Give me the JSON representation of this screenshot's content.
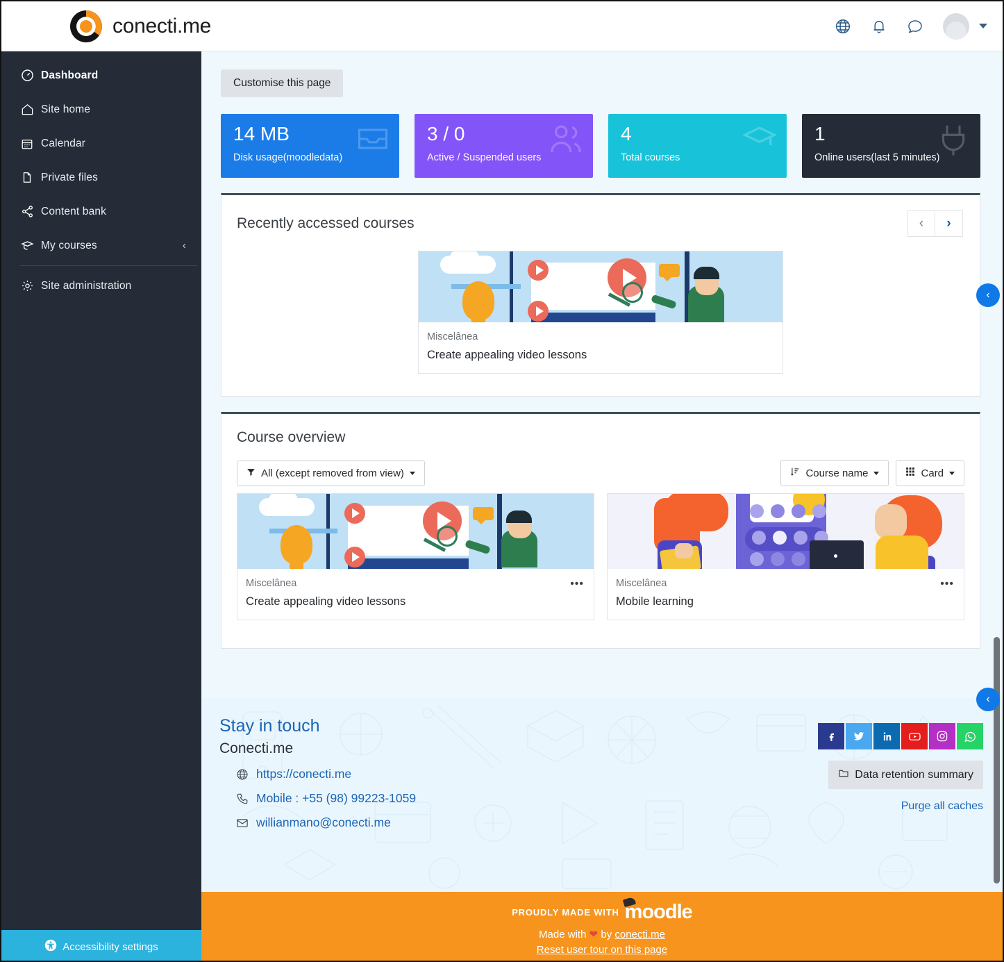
{
  "header": {
    "menu_toggle": "menu-toggle",
    "logo_text": "conecti.me",
    "icons": [
      "globe-icon",
      "bell-icon",
      "message-icon",
      "avatar",
      "chevron-down-icon"
    ]
  },
  "sidebar": {
    "items": [
      {
        "label": "Dashboard",
        "icon": "dashboard-icon",
        "active": true
      },
      {
        "label": "Site home",
        "icon": "home-icon",
        "active": false
      },
      {
        "label": "Calendar",
        "icon": "calendar-icon",
        "active": false
      },
      {
        "label": "Private files",
        "icon": "file-icon",
        "active": false
      },
      {
        "label": "Content bank",
        "icon": "share-icon",
        "active": false
      },
      {
        "label": "My courses",
        "icon": "graduation-cap-icon",
        "active": false,
        "chevron": "‹"
      },
      {
        "label": "Site administration",
        "icon": "gear-icon",
        "active": false
      }
    ],
    "accessibility_label": "Accessibility settings"
  },
  "main": {
    "customise_button": "Customise this page",
    "stats": [
      {
        "value": "14 MB",
        "label": "Disk usage(moodledata)",
        "color": "#1b7ce8",
        "icon": "inbox-icon"
      },
      {
        "value": "3 / 0",
        "label": "Active / Suspended users",
        "color": "#8354f7",
        "icon": "users-icon"
      },
      {
        "value": "4",
        "label": "Total courses",
        "color": "#18c3da",
        "icon": "graduation-cap-icon"
      },
      {
        "value": "1",
        "label": "Online users(last 5 minutes)",
        "color": "#252c38",
        "icon": "plug-icon"
      }
    ],
    "recently_accessed": {
      "title": "Recently accessed courses",
      "prev_label": "‹",
      "next_label": "›",
      "cards": [
        {
          "category": "Miscelânea",
          "name": "Create appealing video lessons",
          "illustration": "video-lessons"
        }
      ]
    },
    "course_overview": {
      "title": "Course overview",
      "filter_label": "All (except removed from view)",
      "sort_label": "Course name",
      "view_label": "Card",
      "cards": [
        {
          "category": "Miscelânea",
          "name": "Create appealing video lessons",
          "illustration": "video-lessons",
          "menu": "•••"
        },
        {
          "category": "Miscelânea",
          "name": "Mobile learning",
          "illustration": "mobile-learning",
          "menu": "•••"
        }
      ]
    }
  },
  "footer": {
    "stay_title": "Stay in touch",
    "brand": "Conecti.me",
    "contacts": [
      {
        "icon": "globe-icon",
        "text": "https://conecti.me"
      },
      {
        "icon": "phone-icon",
        "text": "Mobile : +55 (98) 99223-1059"
      },
      {
        "icon": "mail-icon",
        "text": "willianmano@conecti.me"
      }
    ],
    "socials": [
      {
        "name": "facebook-icon",
        "color": "#2a3b8f"
      },
      {
        "name": "twitter-icon",
        "color": "#4aa8f0"
      },
      {
        "name": "linkedin-icon",
        "color": "#0b6ab0"
      },
      {
        "name": "youtube-icon",
        "color": "#e41d1d"
      },
      {
        "name": "instagram-icon",
        "color": "#b42fc4"
      },
      {
        "name": "whatsapp-icon",
        "color": "#25d366"
      }
    ],
    "data_retention": "Data retention summary",
    "purge_caches": "Purge all caches"
  },
  "moodle_bar": {
    "proudly": "PROUDLY MADE WITH",
    "moodle": "moodle",
    "made_with_prefix": "Made with",
    "heart": "❤",
    "made_with_by": "by",
    "made_with_link": "conecti.me",
    "reset_tour": "Reset user tour on this page"
  },
  "drawers": {
    "toggle_1": "‹",
    "toggle_2": "‹"
  }
}
